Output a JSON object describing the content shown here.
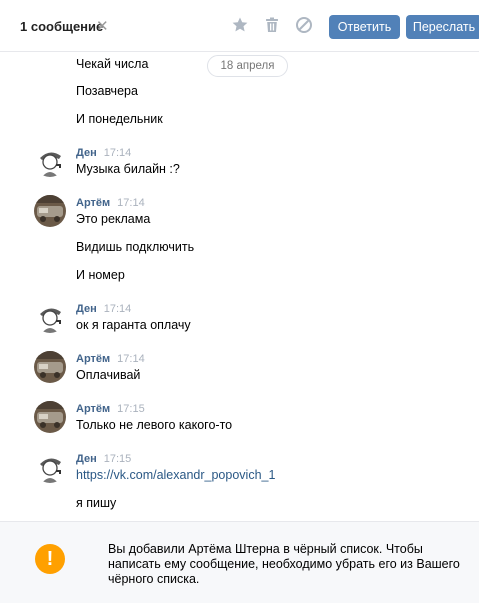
{
  "toolbar": {
    "selected_count": "1 сообщение",
    "close_glyph": "✕",
    "reply_label": "Ответить",
    "forward_label": "Переслать"
  },
  "date_separator": "18 апреля",
  "top_messages": [
    "Чекай числа",
    "Позавчера",
    "И понедельник"
  ],
  "groups": [
    {
      "author": "Ден",
      "time": "17:14",
      "avatar": "detective-avatar",
      "lines": [
        "Музыка билайн :?"
      ]
    },
    {
      "author": "Артём",
      "time": "17:14",
      "avatar": "photo-avatar",
      "lines": [
        "Это реклама",
        "Видишь подключить",
        "И номер"
      ]
    },
    {
      "author": "Ден",
      "time": "17:14",
      "avatar": "detective-avatar",
      "lines": [
        "ок я гаранта оплачу"
      ]
    },
    {
      "author": "Артём",
      "time": "17:14",
      "avatar": "photo-avatar",
      "lines": [
        "Оплачивай"
      ]
    },
    {
      "author": "Артём",
      "time": "17:15",
      "avatar": "photo-avatar",
      "lines": [
        "Только не левого какого-то"
      ]
    },
    {
      "author": "Ден",
      "time": "17:15",
      "avatar": "detective-avatar",
      "link": "https://vk.com/alexandr_popovich_1",
      "lines": [
        "я пишу"
      ]
    }
  ],
  "notice": {
    "icon": "exclamation-icon",
    "text": "Вы добавили Артёма Штерна в чёрный список. Чтобы написать ему сообщение, необходимо убрать его из Вашего чёрного списка."
  },
  "colors": {
    "accent": "#5181b8",
    "author": "#42648b",
    "link": "#2a5885",
    "warning": "#ffa000"
  }
}
